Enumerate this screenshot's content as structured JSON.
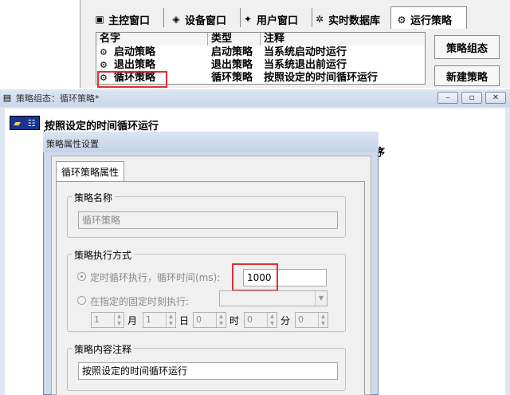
{
  "bg_window": {
    "tabs": [
      {
        "label": "主控窗口",
        "icon": "main-window-icon"
      },
      {
        "label": "设备窗口",
        "icon": "device-icon"
      },
      {
        "label": "用户窗口",
        "icon": "user-window-icon"
      },
      {
        "label": "实时数据库",
        "icon": "database-icon"
      },
      {
        "label": "运行策略",
        "icon": "strategy-icon",
        "active": true
      }
    ],
    "list_headers": [
      "名字",
      "类型",
      "注释"
    ],
    "list_rows": [
      {
        "name": "启动策略",
        "type": "启动策略",
        "note": "当系统启动时运行"
      },
      {
        "name": "退出策略",
        "type": "退出策略",
        "note": "当系统退出前运行"
      },
      {
        "name": "循环策略",
        "type": "循环策略",
        "note": "按照设定的时间循环运行",
        "highlighted": true
      }
    ],
    "buttons": {
      "group": "策略组态",
      "new": "新建策略"
    }
  },
  "cfg_window": {
    "title": "策略组态：循环策略*",
    "min_btn": "–",
    "max_btn": "▫",
    "close_btn": "✕",
    "tree_label": "按照设定的时间循环运行",
    "hidden_label": "序"
  },
  "dialog": {
    "title": "策略属性设置",
    "tab": "循环策略属性",
    "name_group": "策略名称",
    "name_value": "循环策略",
    "exec_group": "策略执行方式",
    "radio_timed": "定时循环执行，循环时间(ms):",
    "timed_value": "1000",
    "radio_fixed": "在指定的固定时刻执行:",
    "spins": [
      {
        "value": "1",
        "unit": "月"
      },
      {
        "value": "1",
        "unit": "日"
      },
      {
        "value": "0",
        "unit": "时"
      },
      {
        "value": "0",
        "unit": "分"
      },
      {
        "value": "0",
        "unit": ""
      }
    ],
    "note_group": "策略内容注释",
    "note_value": "按照设定的时间循环运行"
  },
  "colors": {
    "highlight_box": "#e03030",
    "tree_box": "#1a3590"
  }
}
